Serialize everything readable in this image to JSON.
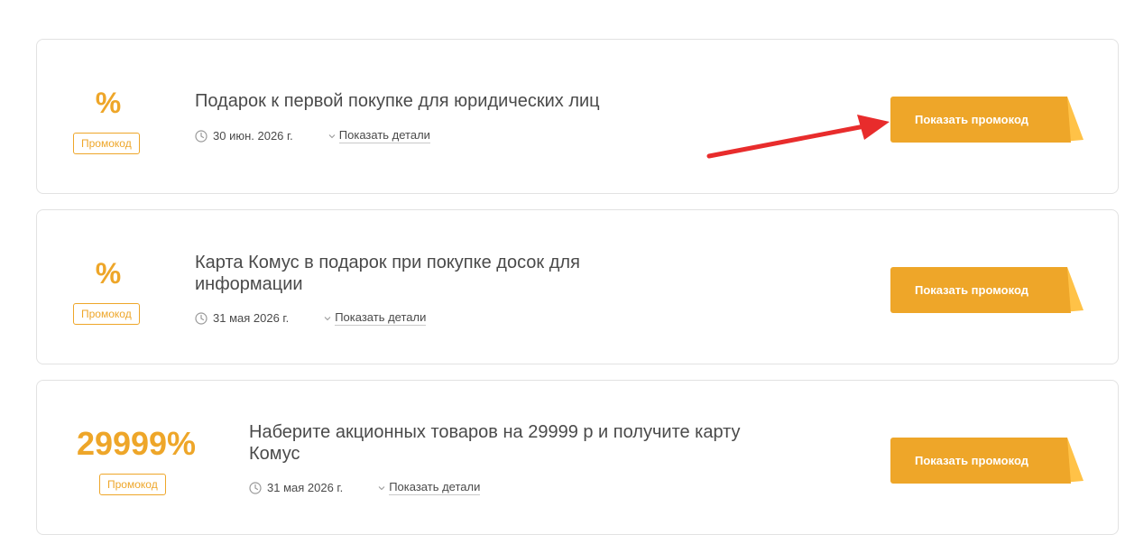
{
  "colors": {
    "accent": "#eea629",
    "button_fold": "#ffc247",
    "text": "#4a4a4a",
    "border": "#e2e2e2",
    "arrow": "#e82c2c"
  },
  "promos": [
    {
      "discount": "%",
      "badge": "Промокод",
      "title": "Подарок к первой покупке для юридических лиц",
      "date": "30 июн. 2026 г.",
      "details_label": "Показать детали",
      "button_label": "Показать промокод"
    },
    {
      "discount": "%",
      "badge": "Промокод",
      "title": "Карта Комус в подарок при покупке досок для информации",
      "date": "31 мая 2026 г.",
      "details_label": "Показать детали",
      "button_label": "Показать промокод"
    },
    {
      "discount": "29999%",
      "badge": "Промокод",
      "title": "Наберите акционных товаров на 29999 р и получите карту Комус",
      "date": "31 мая 2026 г.",
      "details_label": "Показать детали",
      "button_label": "Показать промокод"
    }
  ],
  "icons": {
    "date": "clock-icon",
    "details": "chevron-down-icon",
    "annotation": "red-arrow"
  }
}
